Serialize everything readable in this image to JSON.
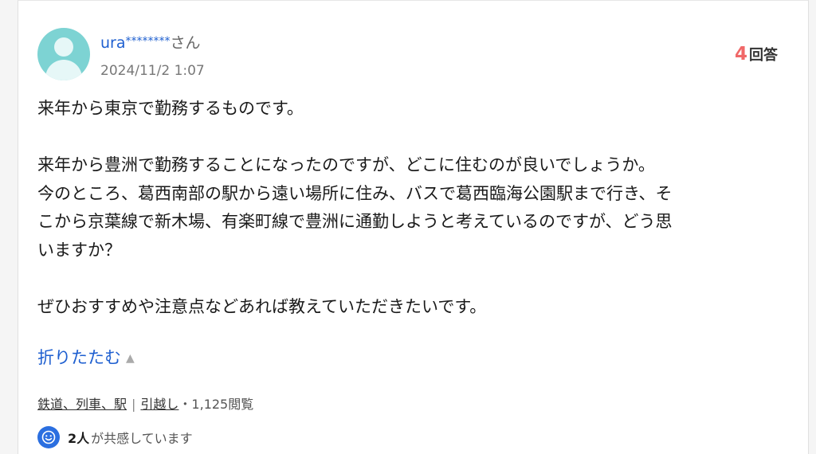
{
  "question": {
    "user_name": "ura",
    "user_masked": "********",
    "user_suffix": "さん",
    "date": "2024/11/2 1:07",
    "answer_count": "4",
    "answer_label": "回答",
    "lines": [
      "来年から東京で勤務するものです。",
      "",
      "来年から豊洲で勤務することになったのですが、どこに住むのが良いでしょうか。",
      "今のところ、葛西南部の駅から遠い場所に住み、バスで葛西臨海公園駅まで行き、そ",
      "こから京葉線で新木場、有楽町線で豊洲に通勤しようと考えているのですが、どう思",
      "いますか？",
      "",
      "ぜひおすすめや注意点などあれば教えていただきたいです。"
    ],
    "collapse_label": "折りたたむ",
    "tags": {
      "category1": "鉄道、列車、駅",
      "category2": "引越し",
      "views": "・1,125閲覧"
    },
    "empathy": {
      "count": "2人",
      "label": "が共感しています"
    }
  }
}
